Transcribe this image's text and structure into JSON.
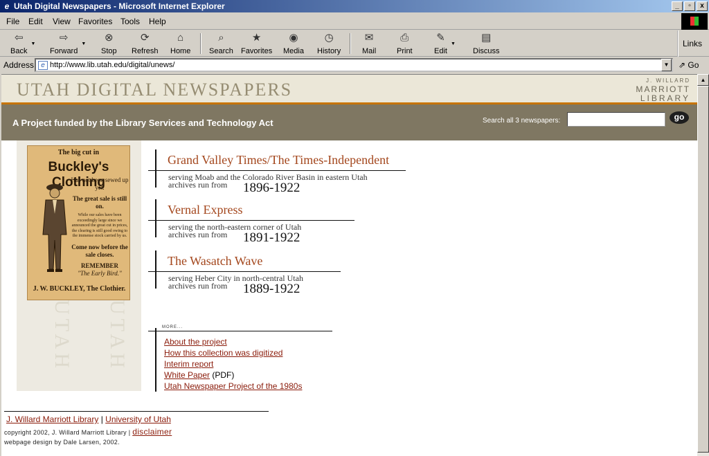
{
  "window": {
    "title": "Utah Digital Newspapers - Microsoft Internet Explorer",
    "buttons": [
      "_",
      "▫",
      "x"
    ]
  },
  "menu": [
    "File",
    "Edit",
    "View",
    "Favorites",
    "Tools",
    "Help"
  ],
  "toolbar": {
    "back": "Back",
    "forward": "Forward",
    "stop": "Stop",
    "refresh": "Refresh",
    "home": "Home",
    "search": "Search",
    "favorites": "Favorites",
    "media": "Media",
    "history": "History",
    "mail": "Mail",
    "print": "Print",
    "edit": "Edit",
    "discuss": "Discuss",
    "links": "Links"
  },
  "address": {
    "label": "Address",
    "url": "http://www.lib.utah.edu/digital/unews/",
    "go": "Go"
  },
  "header": {
    "title": "UTAH DIGITAL NEWSPAPERS",
    "library_line1": "J. WILLARD",
    "library_line2": "MARRIOTT",
    "library_line3": "LIBRARY"
  },
  "band": {
    "project": "A Project funded by the Library Services and Technology Act",
    "search_label": "Search all 3 newspapers:",
    "search_value": "",
    "go": "go"
  },
  "ad": {
    "line1": "The big cut in",
    "line2": "Buckley's Clothing",
    "lines": [
      "Has not been sewed up yet.",
      "The great sale is still on.",
      "While our sales have been exceedingly large since we announced the great cut in prices, the clearing is still good owing to the immense stock carried by us.",
      "Come now before the sale closes.",
      "REMEMBER",
      "\"The Early Bird.\""
    ],
    "footer": "J. W. BUCKLEY, The Clothier."
  },
  "newspapers": [
    {
      "name": "Grand Valley Times/The Times-Independent",
      "serving": "serving Moab and the Colorado River Basin in eastern Utah",
      "archives": "archives run from",
      "years": "1896-1922"
    },
    {
      "name": "Vernal Express",
      "serving": "serving the north-eastern corner of Utah",
      "archives": "archives run from",
      "years": "1891-1922"
    },
    {
      "name": "The Wasatch Wave",
      "serving": "serving Heber City in north-central Utah",
      "archives": "archives run from",
      "years": "1889-1922"
    }
  ],
  "more": {
    "label": "MORE...",
    "links": [
      "About the project",
      "How this collection was digitized",
      "Interim report",
      "White Paper",
      "Utah Newspaper Project of the 1980s"
    ],
    "white_paper_suffix": " (PDF)"
  },
  "footer": {
    "library_link": "J. Willard Marriott Library",
    "separator": "|",
    "university_link": "University of Utah",
    "copyright": "copyright 2002, J. Willard Marriott Library",
    "separator2": "|",
    "disclaimer": "disclaimer",
    "design": "webpage design by Dale Larsen, 2002."
  }
}
